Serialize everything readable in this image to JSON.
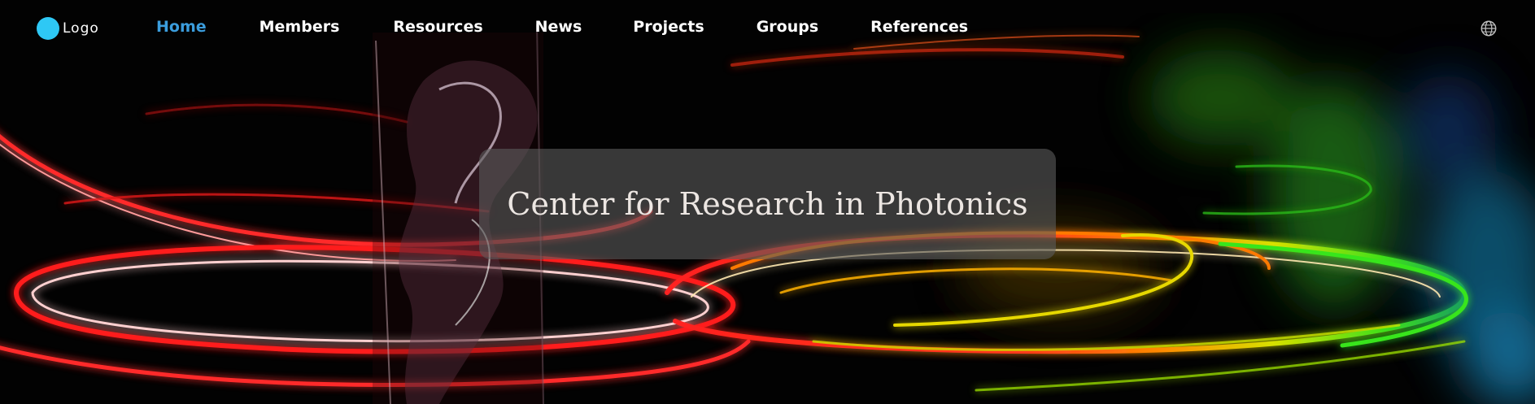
{
  "header": {
    "logo": {
      "text": "Logo",
      "color": "#2ec8f5"
    },
    "nav": [
      {
        "label": "Home",
        "active": true
      },
      {
        "label": "Members",
        "active": false
      },
      {
        "label": "Resources",
        "active": false
      },
      {
        "label": "News",
        "active": false
      },
      {
        "label": "Projects",
        "active": false
      },
      {
        "label": "Groups",
        "active": false
      },
      {
        "label": "References",
        "active": false
      }
    ],
    "active_color": "#3b9ddd",
    "language_icon": "globe-icon"
  },
  "hero": {
    "title": "Center for Research in Photonics"
  }
}
